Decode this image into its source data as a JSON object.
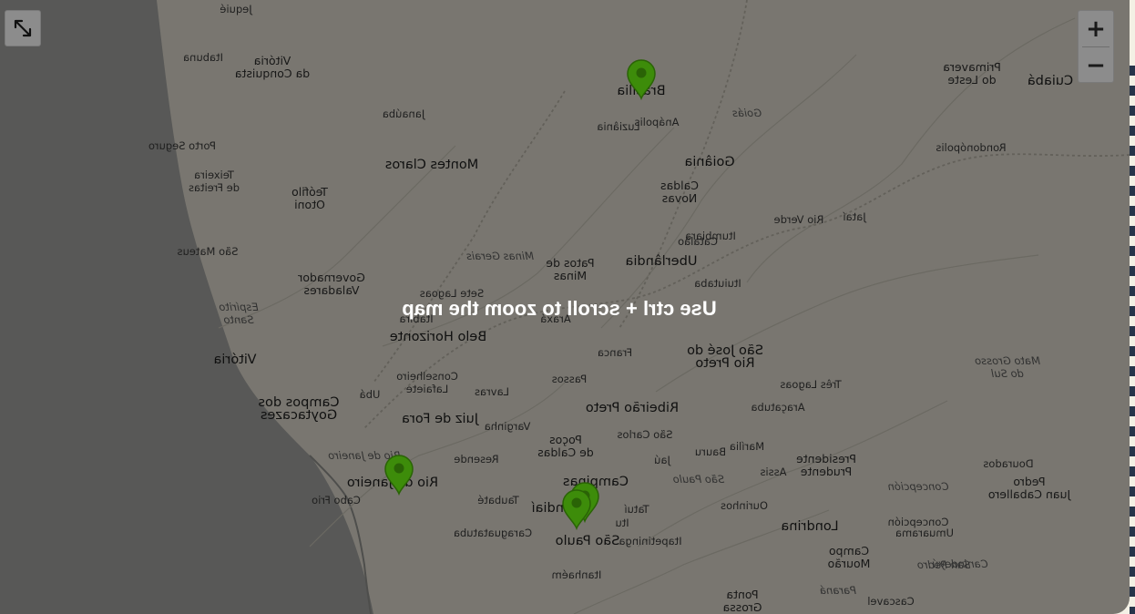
{
  "map": {
    "hint": "Use ctrl + scroll to zoom the map",
    "cities": [
      {
        "name": "Jequié",
        "cls": "small"
      },
      {
        "name": "Itabuna",
        "cls": "small"
      },
      {
        "name": "Vitória\nda Conquista",
        "cls": ""
      },
      {
        "name": "Porto Seguro",
        "cls": "small"
      },
      {
        "name": "Teixeira\nde Freitas",
        "cls": "small"
      },
      {
        "name": "Janaúba",
        "cls": "small"
      },
      {
        "name": "Montes Claros",
        "cls": "big"
      },
      {
        "name": "Teófilo\nOtoni",
        "cls": ""
      },
      {
        "name": "São Mateus",
        "cls": "small"
      },
      {
        "name": "Governador\nValadares",
        "cls": ""
      },
      {
        "name": "Espírito\nSanto",
        "cls": "italic"
      },
      {
        "name": "Vitória",
        "cls": "big"
      },
      {
        "name": "Sete Lagoas",
        "cls": "small"
      },
      {
        "name": "Itabira",
        "cls": "small"
      },
      {
        "name": "Belo Horizonte",
        "cls": "big"
      },
      {
        "name": "Minas Gerais",
        "cls": "italic"
      },
      {
        "name": "Conselheiro\nLafaiete",
        "cls": "small"
      },
      {
        "name": "Ubá",
        "cls": "small"
      },
      {
        "name": "Campos dos\nGoytacazes",
        "cls": "big"
      },
      {
        "name": "Juiz de Fora",
        "cls": "big"
      },
      {
        "name": "Rio de Janeiro",
        "cls": "italic"
      },
      {
        "name": "Rio de Janeiro",
        "cls": "big"
      },
      {
        "name": "Cabo Frio",
        "cls": "small"
      },
      {
        "name": "Resende",
        "cls": "small"
      },
      {
        "name": "Taubaté",
        "cls": "small"
      },
      {
        "name": "Caraguatatuba",
        "cls": "small"
      },
      {
        "name": "Brasília",
        "cls": "big"
      },
      {
        "name": "Luziânia",
        "cls": "small"
      },
      {
        "name": "Anápolis",
        "cls": "small"
      },
      {
        "name": "Goiás",
        "cls": "italic"
      },
      {
        "name": "Goiânia",
        "cls": "big"
      },
      {
        "name": "Caldas\nNovas",
        "cls": ""
      },
      {
        "name": "Itumbiara",
        "cls": "small"
      },
      {
        "name": "Catalão",
        "cls": "small"
      },
      {
        "name": "Rio Verde",
        "cls": "small"
      },
      {
        "name": "Jataí",
        "cls": "small"
      },
      {
        "name": "Patos de\nMinas",
        "cls": ""
      },
      {
        "name": "Uberlândia",
        "cls": "big"
      },
      {
        "name": "Ituiutaba",
        "cls": "small"
      },
      {
        "name": "Araxá",
        "cls": "small"
      },
      {
        "name": "Franca",
        "cls": "small"
      },
      {
        "name": "São José do\nRio Preto",
        "cls": "big"
      },
      {
        "name": "Passos",
        "cls": "small"
      },
      {
        "name": "Lavras",
        "cls": "small"
      },
      {
        "name": "Ribeirão Preto",
        "cls": "big"
      },
      {
        "name": "Araçatuba",
        "cls": "small"
      },
      {
        "name": "Três Lagoas",
        "cls": "small"
      },
      {
        "name": "Varginha",
        "cls": "small"
      },
      {
        "name": "São Carlos",
        "cls": "small"
      },
      {
        "name": "Poços\nde Caldas",
        "cls": ""
      },
      {
        "name": "Jaú",
        "cls": "small"
      },
      {
        "name": "Bauru",
        "cls": "small"
      },
      {
        "name": "Marília",
        "cls": "small"
      },
      {
        "name": "Presidente\nPrudente",
        "cls": ""
      },
      {
        "name": "Assis",
        "cls": "small"
      },
      {
        "name": "Campinas",
        "cls": "big"
      },
      {
        "name": "Jundiaí",
        "cls": "big"
      },
      {
        "name": "São Paulo",
        "cls": "italic"
      },
      {
        "name": "Tatuí",
        "cls": "small"
      },
      {
        "name": "Itu",
        "cls": "small"
      },
      {
        "name": "São Paulo",
        "cls": "big"
      },
      {
        "name": "Itapetininga",
        "cls": "small"
      },
      {
        "name": "Itanhaém",
        "cls": "small"
      },
      {
        "name": "Ourinhos",
        "cls": "small"
      },
      {
        "name": "Londrina",
        "cls": "big"
      },
      {
        "name": "Campo\nMourão",
        "cls": ""
      },
      {
        "name": "Umuarama",
        "cls": "small"
      },
      {
        "name": "Paraná",
        "cls": "italic"
      },
      {
        "name": "Ponta\nGrossa",
        "cls": ""
      },
      {
        "name": "Cascavel",
        "cls": "small"
      },
      {
        "name": "Dourados",
        "cls": "small"
      },
      {
        "name": "Mato Grosso\ndo Sul",
        "cls": "italic"
      },
      {
        "name": "Pedro\nJuan Caballero",
        "cls": ""
      },
      {
        "name": "Concepción",
        "cls": "italic"
      },
      {
        "name": "Concepción",
        "cls": "small"
      },
      {
        "name": "Canindeyú",
        "cls": "italic"
      },
      {
        "name": "San Pedro",
        "cls": "italic"
      },
      {
        "name": "Rondonópolis",
        "cls": "small"
      },
      {
        "name": "Primavera\ndo Leste",
        "cls": ""
      },
      {
        "name": "Cuiabá",
        "cls": "big"
      }
    ],
    "markers_count": 4,
    "colors": {
      "marker": "#3d8c0a",
      "marker_dark": "#2a6306",
      "overlay": "rgba(0,0,0,0.45)",
      "controls": "#8c8c8c"
    }
  },
  "controls": {
    "zoom_in": "+",
    "zoom_out": "−",
    "fullscreen_icon": "expand-icon"
  }
}
